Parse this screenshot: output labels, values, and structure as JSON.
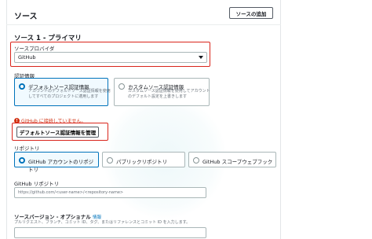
{
  "header": {
    "title": "ソース",
    "add_source_label": "ソースの追加"
  },
  "source": {
    "section_title": "ソース 1 - プライマリ",
    "provider_label": "ソースプロバイダ",
    "provider_value": "GitHub"
  },
  "auth": {
    "label": "認証情報",
    "options": [
      {
        "title": "デフォルトソース認証情報",
        "desc": "アカウントのデフォルトソース認証情報を使用してすべてのプロジェクトに適用します",
        "selected": true
      },
      {
        "title": "カスタムソース認証情報",
        "desc": "カスタムソース認証情報を使用してアカウントのデフォルト設定を上書きします",
        "selected": false
      }
    ],
    "error_text": "GitHub に接続していません。",
    "manage_label": "デフォルトソース認証情報を管理"
  },
  "repository": {
    "label": "リポジトリ",
    "options": [
      {
        "title": "GitHub アカウントのリポジトリ",
        "selected": true
      },
      {
        "title": "パブリックリポジトリ",
        "selected": false
      },
      {
        "title": "GitHub スコープウェブフック",
        "selected": false
      }
    ]
  },
  "github_repo": {
    "label": "GitHub リポジトリ",
    "placeholder": "https://github.com/<user-name>/<repository-name>"
  },
  "source_version": {
    "label": "ソースバージョン - オプショナル",
    "info": "情報",
    "hint": "プルリクエスト、ブランチ、コミット ID、タグ、またはリファレンスとコミット ID を入力します。"
  },
  "colors": {
    "accent": "#0073bb",
    "highlight": "#d9251c",
    "error": "#d13212"
  }
}
